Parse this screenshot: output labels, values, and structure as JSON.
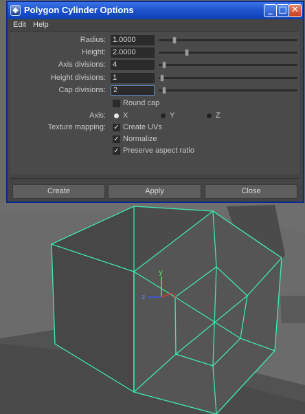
{
  "window": {
    "title": "Polygon Cylinder Options"
  },
  "menu": {
    "edit": "Edit",
    "help": "Help"
  },
  "fields": {
    "radius": {
      "label": "Radius:",
      "value": "1.0000",
      "slider_position": 0.17
    },
    "height": {
      "label": "Height:",
      "value": "2.0000",
      "slider_position": 0.22
    },
    "axis_divisions": {
      "label": "Axis divisions:",
      "value": "4",
      "slider_position": 0.03
    },
    "height_divisions": {
      "label": "Height divisions:",
      "value": "1",
      "slider_position": 0.0
    },
    "cap_divisions": {
      "label": "Cap divisions:",
      "value": "2",
      "slider_position": 0.03
    }
  },
  "round_cap": {
    "label": "Round cap",
    "checked": false
  },
  "axis": {
    "label": "Axis:",
    "options": [
      "X",
      "Y",
      "Z"
    ],
    "selected": "X"
  },
  "texture_mapping": {
    "label": "Texture mapping:",
    "create_uvs": "Create UVs",
    "normalize": "Normalize",
    "preserve_aspect": "Preserve aspect ratio"
  },
  "buttons": {
    "create": "Create",
    "apply": "Apply",
    "close": "Close"
  },
  "viewport": {
    "gizmo": {
      "x": "x",
      "y": "y",
      "z": "z"
    },
    "colors": {
      "wireframe": "#3ee8b0",
      "background": "#6b6b6b",
      "dialog": "#444444",
      "titlebar": "#1e55cf"
    }
  }
}
